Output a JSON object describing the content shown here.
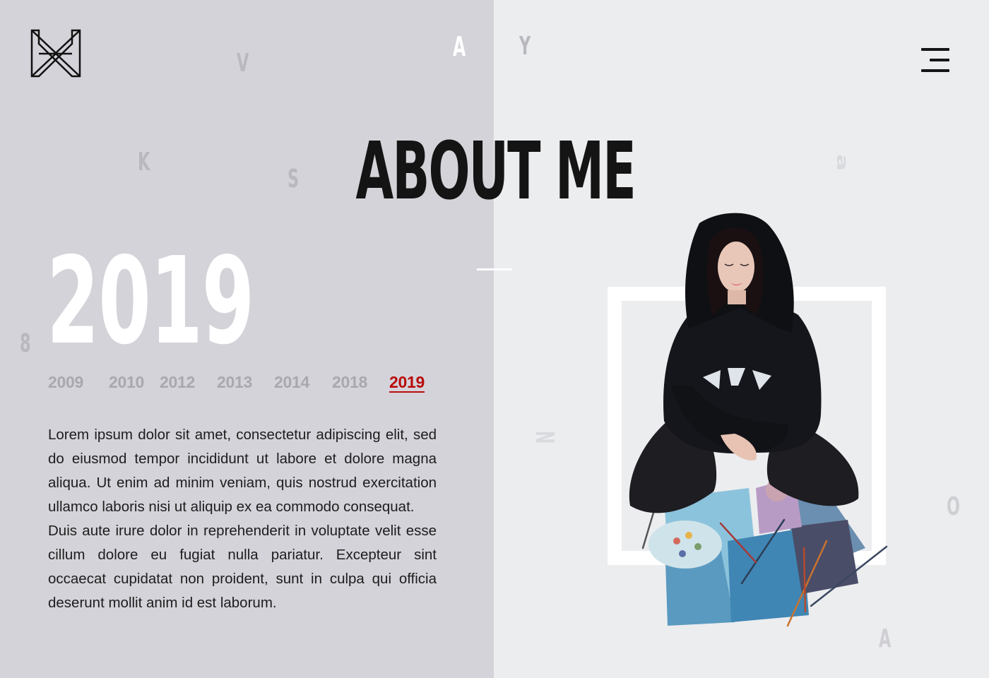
{
  "page": {
    "title": "ABOUT ME",
    "current_year": "2019"
  },
  "timeline": {
    "years": [
      "2009",
      "2010",
      "2012",
      "2013",
      "2014",
      "2018",
      "2019"
    ],
    "active": "2019"
  },
  "bio": {
    "paragraphs": [
      "Lorem ipsum dolor sit amet, consectetur adipiscing elit, sed do eiusmod tempor incididunt ut labore et dolore magna aliqua. Ut enim ad minim veniam, quis nostrud exercitation ullamco laboris nisi ut aliquip ex ea commodo consequat.",
      "Duis aute irure dolor in reprehenderit in voluptate velit esse cillum dolore eu fugiat nulla pariatur. Excepteur sint occaecat cupidatat non proident, sunt in culpa qui officia deserunt mollit anim id est laborum."
    ]
  },
  "decor_letters": [
    "A",
    "Y",
    "V",
    "K",
    "S",
    "8",
    "a",
    "N",
    "O",
    "A"
  ],
  "icons": {
    "logo": "monogram-logo-icon",
    "menu": "hamburger-menu-icon"
  },
  "colors": {
    "left_panel": "#d4d3d9",
    "right_panel": "#ecedef",
    "accent": "#b90c0c",
    "heading": "#141414"
  }
}
